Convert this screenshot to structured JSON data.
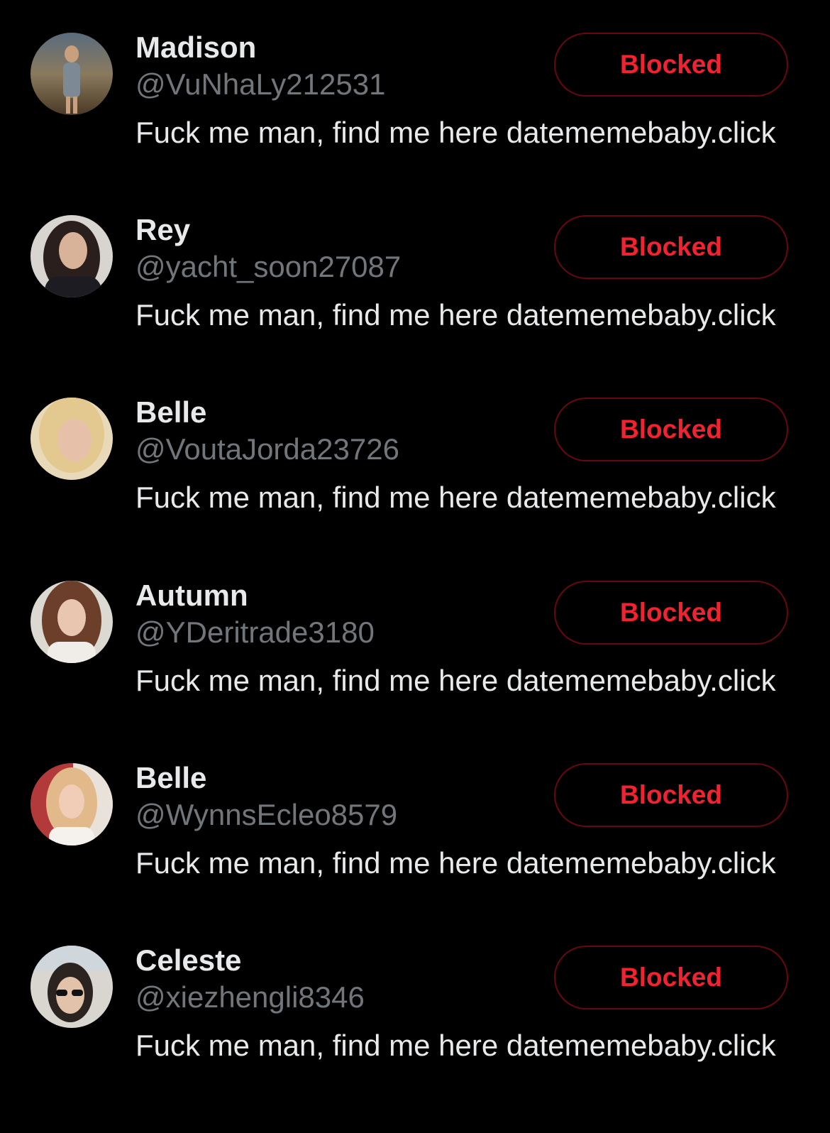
{
  "colors": {
    "background": "#000000",
    "name_text": "#e7e9ea",
    "handle_text": "#71767b",
    "blocked_text": "#f4212e",
    "blocked_border": "#67070f"
  },
  "users": [
    {
      "name": "Madison",
      "handle": "@VuNhaLy212531",
      "bio": "Fuck me man, find me here datememebaby.click",
      "button_label": "Blocked",
      "avatar_icon": "avatar-photo"
    },
    {
      "name": "Rey",
      "handle": "@yacht_soon27087",
      "bio": "Fuck me man, find me here datememebaby.click",
      "button_label": "Blocked",
      "avatar_icon": "avatar-photo"
    },
    {
      "name": "Belle",
      "handle": "@VoutaJorda23726",
      "bio": "Fuck me man, find me here datememebaby.click",
      "button_label": "Blocked",
      "avatar_icon": "avatar-photo"
    },
    {
      "name": "Autumn",
      "handle": "@YDeritrade3180",
      "bio": "Fuck me man, find me here datememebaby.click",
      "button_label": "Blocked",
      "avatar_icon": "avatar-photo"
    },
    {
      "name": "Belle",
      "handle": "@WynnsEcleo8579",
      "bio": "Fuck me man, find me here datememebaby.click",
      "button_label": "Blocked",
      "avatar_icon": "avatar-photo"
    },
    {
      "name": "Celeste",
      "handle": "@xiezhengli8346",
      "bio": "Fuck me man, find me here datememebaby.click",
      "button_label": "Blocked",
      "avatar_icon": "avatar-photo"
    }
  ]
}
